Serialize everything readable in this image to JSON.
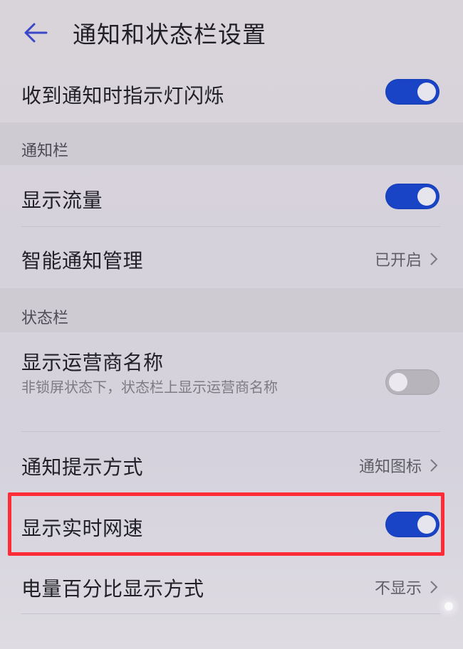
{
  "header": {
    "title": "通知和状态栏设置",
    "back_icon": "arrow-left-icon"
  },
  "colors": {
    "accent": "#1a44c6",
    "highlight_border": "#ff2b36",
    "toggle_off": "#b7b4bc"
  },
  "rows": {
    "led_flash": {
      "label": "收到通知时指示灯闪烁",
      "enabled": true
    },
    "show_traffic": {
      "label": "显示流量",
      "enabled": true
    },
    "smart_notify": {
      "label": "智能通知管理",
      "value": "已开启"
    },
    "carrier_name": {
      "label": "显示运营商名称",
      "subtitle": "非锁屏状态下，状态栏上显示运营商名称",
      "enabled": false
    },
    "notify_style": {
      "label": "通知提示方式",
      "value": "通知图标"
    },
    "realtime_speed": {
      "label": "显示实时网速",
      "enabled": true
    },
    "battery_percent": {
      "label": "电量百分比显示方式",
      "value": "不显示"
    }
  },
  "sections": {
    "notification_bar": "通知栏",
    "status_bar": "状态栏"
  }
}
